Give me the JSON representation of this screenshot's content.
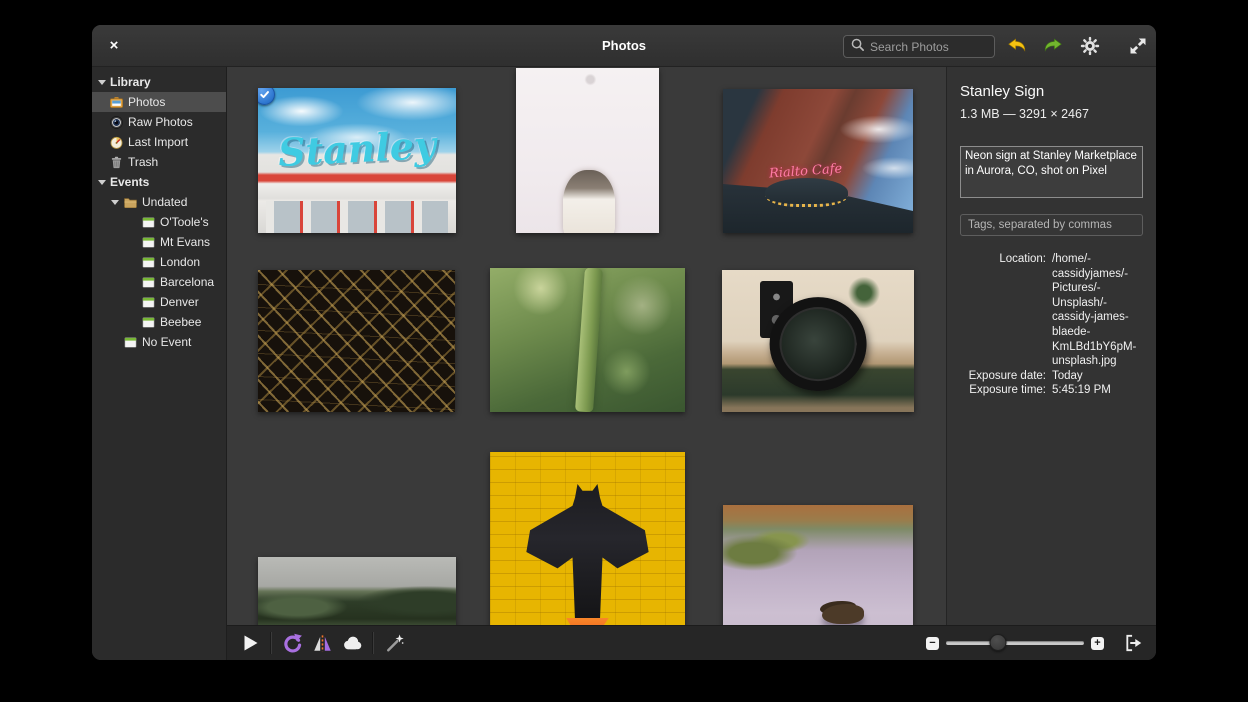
{
  "window": {
    "title": "Photos"
  },
  "header": {
    "close_label": "×",
    "search": {
      "placeholder": "Search Photos"
    }
  },
  "sidebar": {
    "sections": [
      {
        "label": "Library",
        "items": [
          {
            "label": "Photos",
            "icon": "photos-icon",
            "selected": true
          },
          {
            "label": "Raw Photos",
            "icon": "camera-lens-icon"
          },
          {
            "label": "Last Import",
            "icon": "last-import-clock-icon"
          },
          {
            "label": "Trash",
            "icon": "trash-icon"
          }
        ]
      },
      {
        "label": "Events",
        "items": [
          {
            "label": "Undated",
            "icon": "folder-icon",
            "expanded": true,
            "children": [
              {
                "label": "O'Toole's",
                "icon": "event-icon"
              },
              {
                "label": "Mt Evans",
                "icon": "event-icon"
              },
              {
                "label": "London",
                "icon": "event-icon"
              },
              {
                "label": "Barcelona",
                "icon": "event-icon"
              },
              {
                "label": "Denver",
                "icon": "event-icon"
              },
              {
                "label": "Beebee",
                "icon": "event-icon"
              }
            ]
          },
          {
            "label": "No Event",
            "icon": "event-icon"
          }
        ]
      }
    ]
  },
  "photos": [
    {
      "name": "stanley-sign",
      "selected": true,
      "overlay_text": "Stanley"
    },
    {
      "name": "cat-looking-up"
    },
    {
      "name": "rialto-cafe-building",
      "overlay_text": "Rialto Cafe"
    },
    {
      "name": "gold-circuit-board"
    },
    {
      "name": "succulent-macro"
    },
    {
      "name": "tele-lens-on-map"
    },
    {
      "name": "forest-valley"
    },
    {
      "name": "lego-batman"
    },
    {
      "name": "duck-on-pond"
    }
  ],
  "info_panel": {
    "title": "Stanley Sign",
    "meta": "1.3 MB — 3291 × 2467",
    "description": "Neon sign at Stanley Marketplace in Aurora, CO, shot on Pixel",
    "tags_placeholder": "Tags, separated by commas",
    "fields": [
      {
        "label": "Location:",
        "value": "/home/-\ncassidyjames/-\nPictures/-\nUnsplash/-\ncassidy-james-\nblaede-\nKmLBd1bY6pM-\nunsplash.jpg"
      },
      {
        "label": "Exposure date:",
        "value": "Today"
      },
      {
        "label": "Exposure time:",
        "value": "5:45:19 PM"
      }
    ]
  },
  "bottom_toolbar": {
    "zoom_out_label": "−",
    "zoom_in_label": "+",
    "slider_position_percent": 38
  },
  "colors": {
    "selection_accent": "#3689e6",
    "undo_arrow": "#f5c211",
    "redo_arrow": "#72b62e",
    "rotate_arrow": "#a970e0",
    "flip_divider": "#f37329"
  }
}
